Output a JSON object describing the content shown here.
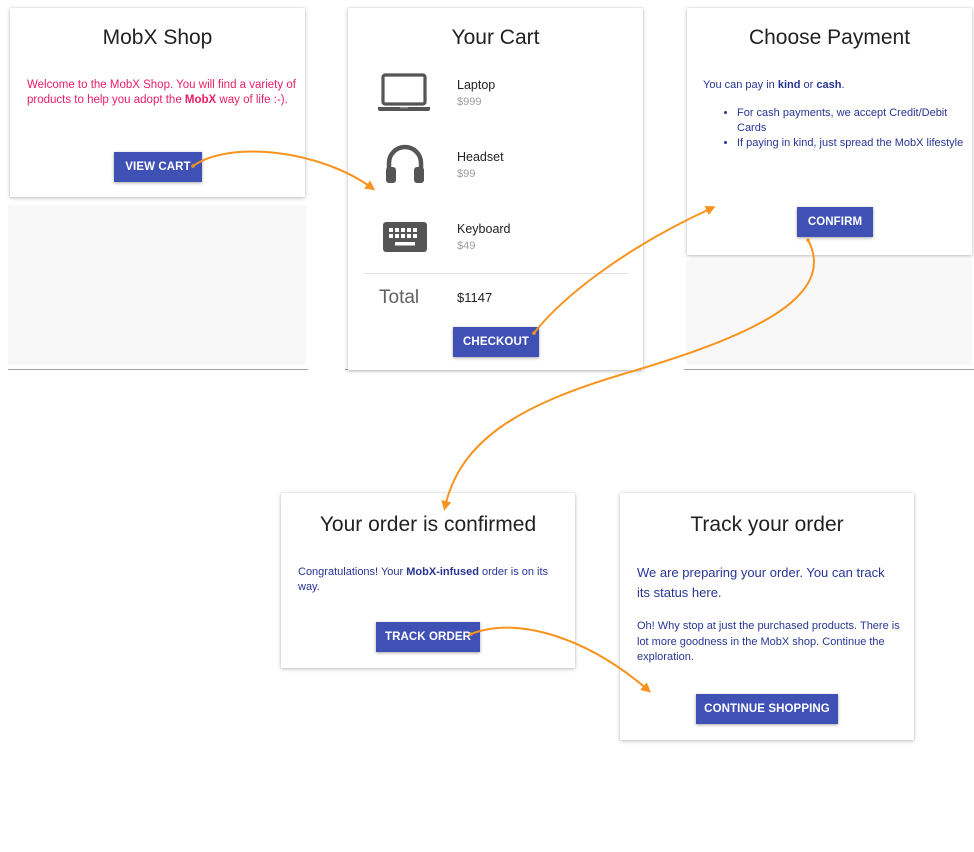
{
  "shop_card": {
    "title": "MobX Shop",
    "intro_before": "Welcome to the MobX Shop. You will find a variety of products to help you adopt the ",
    "intro_bold": "MobX",
    "intro_after": " way of life :-).",
    "button_label": "VIEW CART"
  },
  "cart_card": {
    "title": "Your Cart",
    "items": [
      {
        "name": "Laptop",
        "price": "$999",
        "icon": "laptop-icon"
      },
      {
        "name": "Headset",
        "price": "$99",
        "icon": "headset-icon"
      },
      {
        "name": "Keyboard",
        "price": "$49",
        "icon": "keyboard-icon"
      }
    ],
    "total_label": "Total",
    "total_value": "$1147",
    "button_label": "CHECKOUT"
  },
  "payment_card": {
    "title": "Choose Payment",
    "intro_a": "You can pay in ",
    "intro_kind": "kind",
    "intro_or": " or ",
    "intro_cash": "cash",
    "intro_end": ".",
    "bullets": [
      "For cash payments, we accept Credit/Debit Cards",
      "If paying in kind, just spread the MobX lifestyle"
    ],
    "button_label": "CONFIRM"
  },
  "confirmed_card": {
    "title": "Your order is confirmed",
    "text_before": "Congratulations! Your ",
    "text_bold": "MobX-infused",
    "text_after": " order is on its way.",
    "button_label": "TRACK ORDER"
  },
  "track_card": {
    "title": "Track your order",
    "status_text": "We are preparing your order. You can track its status here.",
    "more_text": "Oh! Why stop at just the purchased products. There is lot more goodness in the MobX shop. Continue the exploration.",
    "button_label": "CONTINUE SHOPPING"
  },
  "colors": {
    "accent": "#3f51b5",
    "pink_text": "#e91e63",
    "blue_text": "#283593",
    "arrow": "#f7931e"
  }
}
